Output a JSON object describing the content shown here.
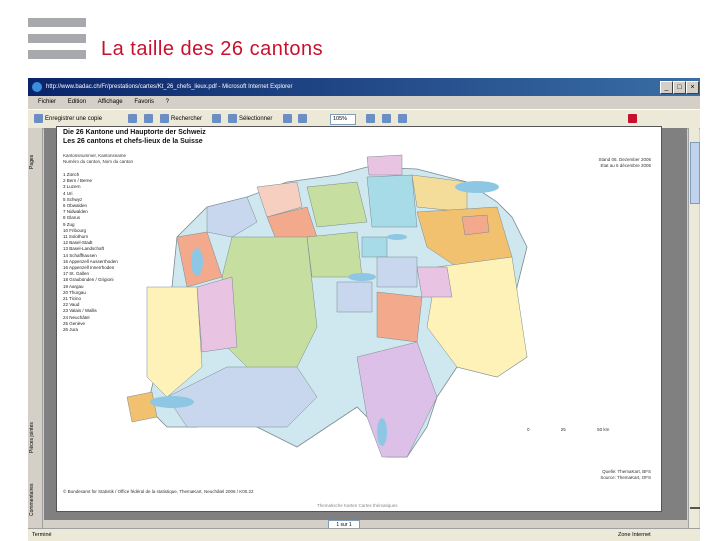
{
  "slide": {
    "title": "La taille des 26 cantons"
  },
  "browser": {
    "window_title": "http://www.badac.ch/Fr/prestations/cartes/Kt_26_chefs_lieux.pdf - Microsoft Internet Explorer",
    "menu": [
      "Fichier",
      "Edition",
      "Affichage",
      "Favoris",
      "?"
    ],
    "toolbar": {
      "save_label": "Enregistrer une copie",
      "select_label": "Sélectionner",
      "zoom_value": "105%",
      "search_label": "Rechercher"
    },
    "side_tabs": [
      "Pages",
      "Pièces jointes",
      "Commentaires"
    ],
    "page_indicator": "1 sur 1",
    "status_left": "Terminé",
    "status_right": "Zone Internet"
  },
  "map": {
    "title_de": "Die 26 Kantone und Hauptorte der Schweiz",
    "title_fr": "Les 26 cantons et chefs-lieux de la Suisse",
    "legend_head_1": "Kantonsnummer, Kantonsname",
    "legend_head_2": "Numéro du canton, Nom du canton",
    "stand_1": "Stand 05. Dezember 2006",
    "stand_2": "Etat au 5 décembre 2006",
    "cantons": [
      "1 Zürich",
      "2 Bern / Berne",
      "3 Luzern",
      "4 Uri",
      "5 Schwyz",
      "6 Obwalden",
      "7 Nidwalden",
      "8 Glarus",
      "9 Zug",
      "10 Fribourg",
      "11 Solothurn",
      "12 Basel-Stadt",
      "13 Basel-Landschaft",
      "14 Schaffhausen",
      "15 Appenzell Ausserrhoden",
      "16 Appenzell Innerrhoden",
      "17 St. Gallen",
      "18 Graubünden / Grigioni",
      "19 Aargau",
      "20 Thurgau",
      "21 Ticino",
      "22 Vaud",
      "23 Valais / Wallis",
      "24 Neuchâtel",
      "25 Genève",
      "26 Jura"
    ],
    "capitals": [
      "Schaffhausen",
      "Basel",
      "Delémont",
      "Liestal",
      "Aarau",
      "Zürich",
      "Frauenfeld",
      "St. Gallen",
      "Herisau",
      "Appenzell",
      "Solothurn",
      "Luzern",
      "Zug",
      "Schwyz",
      "Glarus",
      "Chur",
      "Bern",
      "Neuchâtel",
      "Fribourg",
      "Sarnen",
      "Stans",
      "Altdorf",
      "Lausanne",
      "Genève",
      "Sion",
      "Bellinzona"
    ],
    "scale_labels": [
      "0",
      "25",
      "50 km"
    ],
    "footer_left": "© Bundesamt für Statistik / Office fédéral de la statistique, ThemaKart, Neuchâtel 2006 / K00.22",
    "footer_mid": "Thematische Karten     Cartes thématiques",
    "footer_right_1": "Quelle: ThemaKart, BFS",
    "footer_right_2": "Source: ThemaKart, OFS"
  },
  "colors": {
    "title_red": "#c8102e",
    "map_bg": "#cfe7ee",
    "lake": "#8ec7e3"
  }
}
